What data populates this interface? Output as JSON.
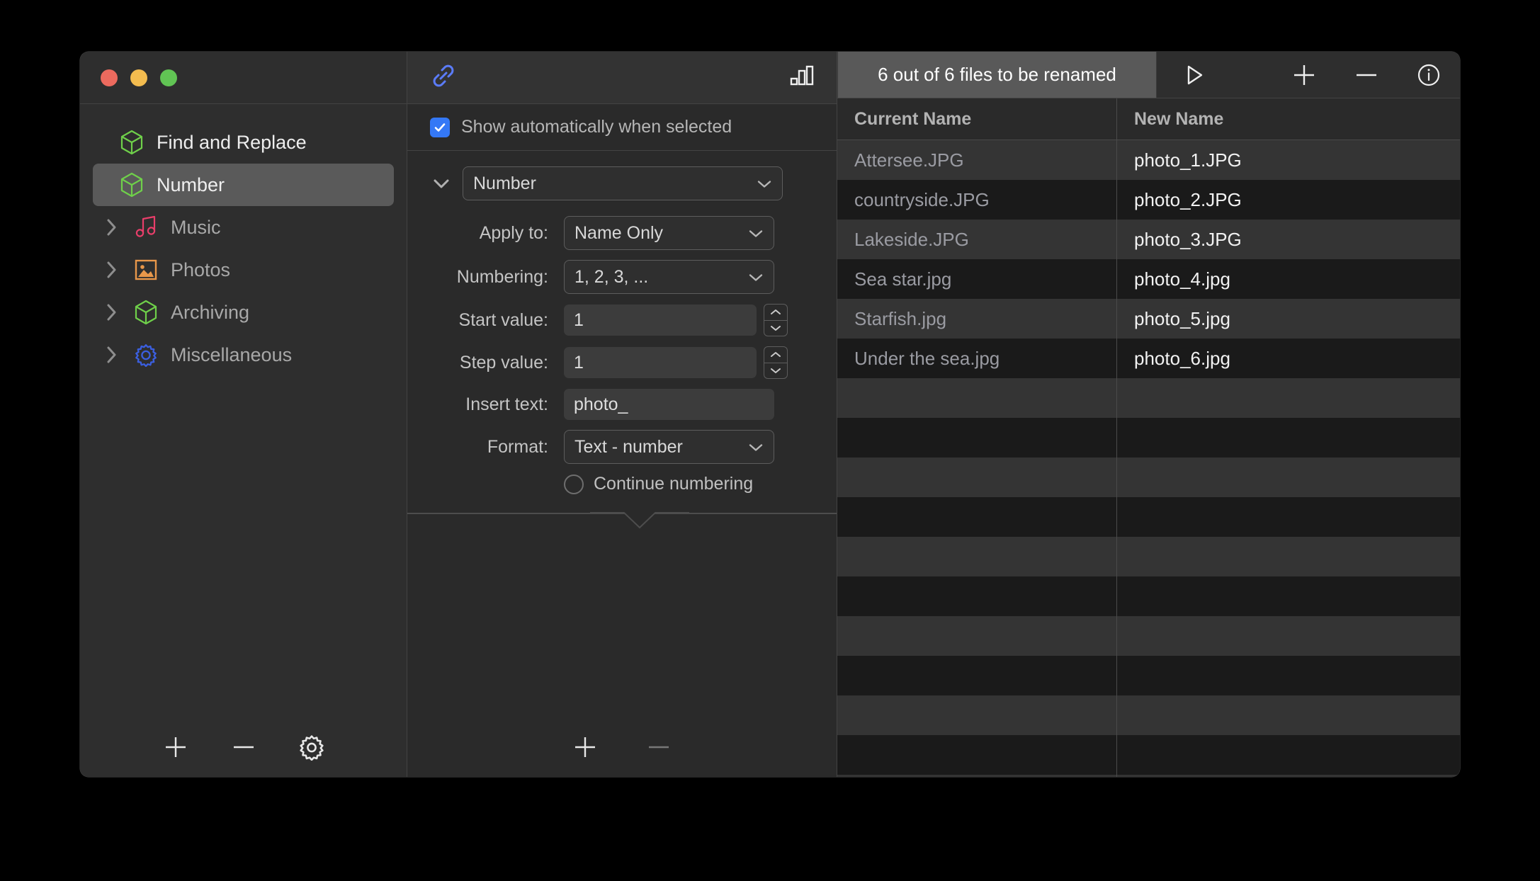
{
  "window": {
    "traffic_lights": [
      "close",
      "minimize",
      "zoom"
    ],
    "colors": {
      "close": "#ec6a5e",
      "minimize": "#f3bc4f",
      "zoom": "#61c454",
      "accent_blue": "#3478f6",
      "cube_green": "#6fd04a",
      "music_pink": "#e83e6a",
      "photo_orange": "#e8974a",
      "gear_blue": "#3b5fe0",
      "link_blue": "#5b7cfa",
      "selected_row": "#5a5a5a"
    }
  },
  "sidebar": {
    "items": [
      {
        "label": "Find and Replace",
        "icon": "cube-icon",
        "expandable": false,
        "selected": false
      },
      {
        "label": "Number",
        "icon": "cube-icon",
        "expandable": false,
        "selected": true
      },
      {
        "label": "Music",
        "icon": "music-note-icon",
        "expandable": true,
        "selected": false
      },
      {
        "label": "Photos",
        "icon": "photo-icon",
        "expandable": true,
        "selected": false
      },
      {
        "label": "Archiving",
        "icon": "cube-icon",
        "expandable": true,
        "selected": false
      },
      {
        "label": "Miscellaneous",
        "icon": "gear-icon",
        "expandable": true,
        "selected": false
      }
    ],
    "footer": [
      {
        "icon": "plus-icon",
        "name": "add-preset-button"
      },
      {
        "icon": "minus-icon",
        "name": "remove-preset-button"
      },
      {
        "icon": "gear-icon",
        "name": "preset-settings-button"
      }
    ]
  },
  "middle": {
    "toolbar": {
      "link_icon": "link-icon",
      "chart_icon": "bar-chart-icon"
    },
    "auto_show": {
      "label": "Show automatically when selected",
      "checked": true
    },
    "action": {
      "disclosure": "chevron-down-icon",
      "type_value": "Number",
      "fields": [
        {
          "label": "Apply to:",
          "control": "select",
          "value": "Name Only"
        },
        {
          "label": "Numbering:",
          "control": "select",
          "value": "1, 2, 3, ..."
        },
        {
          "label": "Start value:",
          "control": "stepper-input",
          "value": "1"
        },
        {
          "label": "Step value:",
          "control": "stepper-input",
          "value": "1"
        },
        {
          "label": "Insert text:",
          "control": "text",
          "value": "photo_"
        },
        {
          "label": "Format:",
          "control": "select",
          "value": "Text - number"
        }
      ],
      "continue_numbering": {
        "label": "Continue numbering",
        "checked": false
      }
    },
    "footer": [
      {
        "icon": "plus-icon",
        "name": "add-action-button",
        "enabled": true
      },
      {
        "icon": "minus-icon",
        "name": "remove-action-button",
        "enabled": false
      }
    ]
  },
  "right": {
    "toolbar": {
      "status": "6 out of 6 files to be renamed",
      "play_icon": "play-icon",
      "buttons": [
        {
          "icon": "plus-icon",
          "name": "add-files-button"
        },
        {
          "icon": "minus-icon",
          "name": "remove-files-button"
        },
        {
          "icon": "info-icon",
          "name": "info-button"
        }
      ]
    },
    "table": {
      "columns": [
        "Current Name",
        "New Name"
      ],
      "rows": [
        {
          "current": "Attersee.JPG",
          "new": "photo_1.JPG"
        },
        {
          "current": "countryside.JPG",
          "new": "photo_2.JPG"
        },
        {
          "current": "Lakeside.JPG",
          "new": "photo_3.JPG"
        },
        {
          "current": "Sea star.jpg",
          "new": "photo_4.jpg"
        },
        {
          "current": "Starfish.jpg",
          "new": "photo_5.jpg"
        },
        {
          "current": "Under the sea.jpg",
          "new": "photo_6.jpg"
        }
      ],
      "empty_rows": 12
    }
  }
}
